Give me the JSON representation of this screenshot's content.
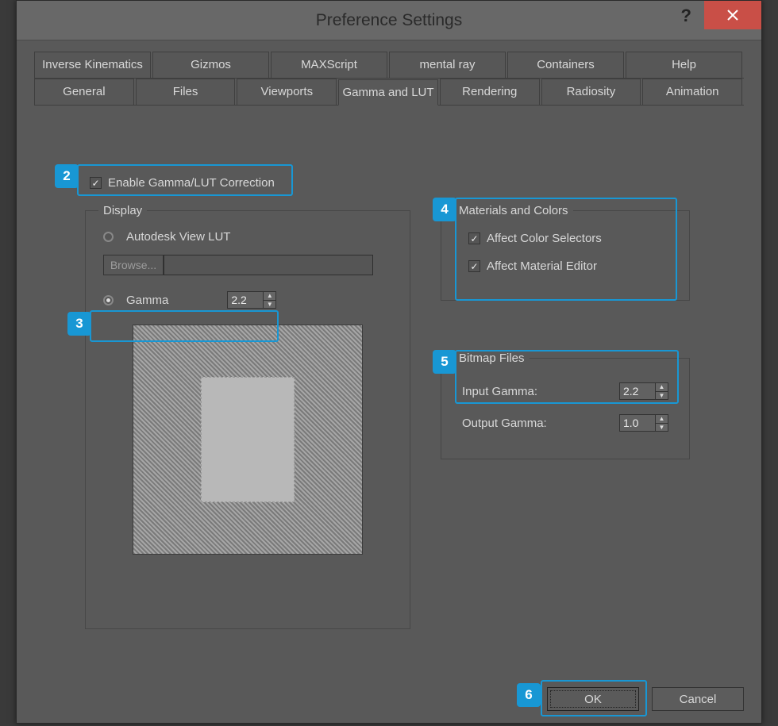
{
  "window": {
    "title": "Preference Settings"
  },
  "tabs_row1": [
    "Inverse Kinematics",
    "Gizmos",
    "MAXScript",
    "mental ray",
    "Containers",
    "Help"
  ],
  "tabs_row2": [
    "General",
    "Files",
    "Viewports",
    "Gamma and LUT",
    "Rendering",
    "Radiosity",
    "Animation"
  ],
  "active_tab": "Gamma and LUT",
  "enable_label": "Enable Gamma/LUT Correction",
  "display": {
    "legend": "Display",
    "viewlut_label": "Autodesk View LUT",
    "browse_label": "Browse...",
    "gamma_label": "Gamma",
    "gamma_value": "2.2"
  },
  "materials": {
    "legend": "Materials and Colors",
    "affect_selectors": "Affect Color Selectors",
    "affect_material": "Affect Material Editor"
  },
  "bitmap": {
    "legend": "Bitmap Files",
    "input_label": "Input Gamma:",
    "input_value": "2.2",
    "output_label": "Output Gamma:",
    "output_value": "1.0"
  },
  "buttons": {
    "ok": "OK",
    "cancel": "Cancel"
  },
  "markers": {
    "m2": "2",
    "m3": "3",
    "m4": "4",
    "m5": "5",
    "m6": "6"
  }
}
